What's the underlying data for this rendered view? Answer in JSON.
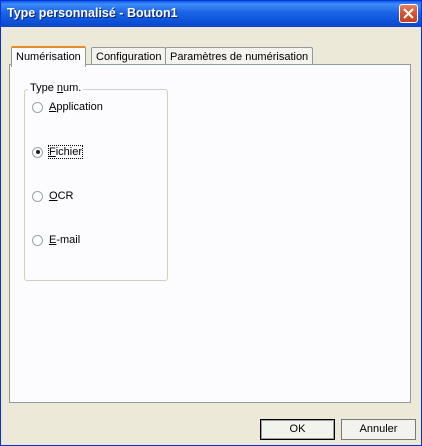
{
  "window": {
    "title": "Type personnalisé - Bouton1"
  },
  "tabs": [
    {
      "label": "Numérisation",
      "active": true
    },
    {
      "label": "Configuration",
      "active": false
    },
    {
      "label": "Paramètres de numérisation",
      "active": false
    }
  ],
  "group": {
    "legend_prefix": "Type ",
    "legend_access": "n",
    "legend_suffix": "um."
  },
  "options": [
    {
      "access": "A",
      "rest": "pplication",
      "checked": false
    },
    {
      "access": "F",
      "rest": "ichier",
      "checked": true
    },
    {
      "access": "O",
      "rest": "CR",
      "checked": false
    },
    {
      "access": "E",
      "rest": "-mail",
      "checked": false
    }
  ],
  "buttons": {
    "ok": "OK",
    "cancel": "Annuler"
  },
  "colors": {
    "titlebar": "#0a5ce8",
    "dialog_bg": "#ece9d8",
    "close_button": "#d6532f"
  }
}
